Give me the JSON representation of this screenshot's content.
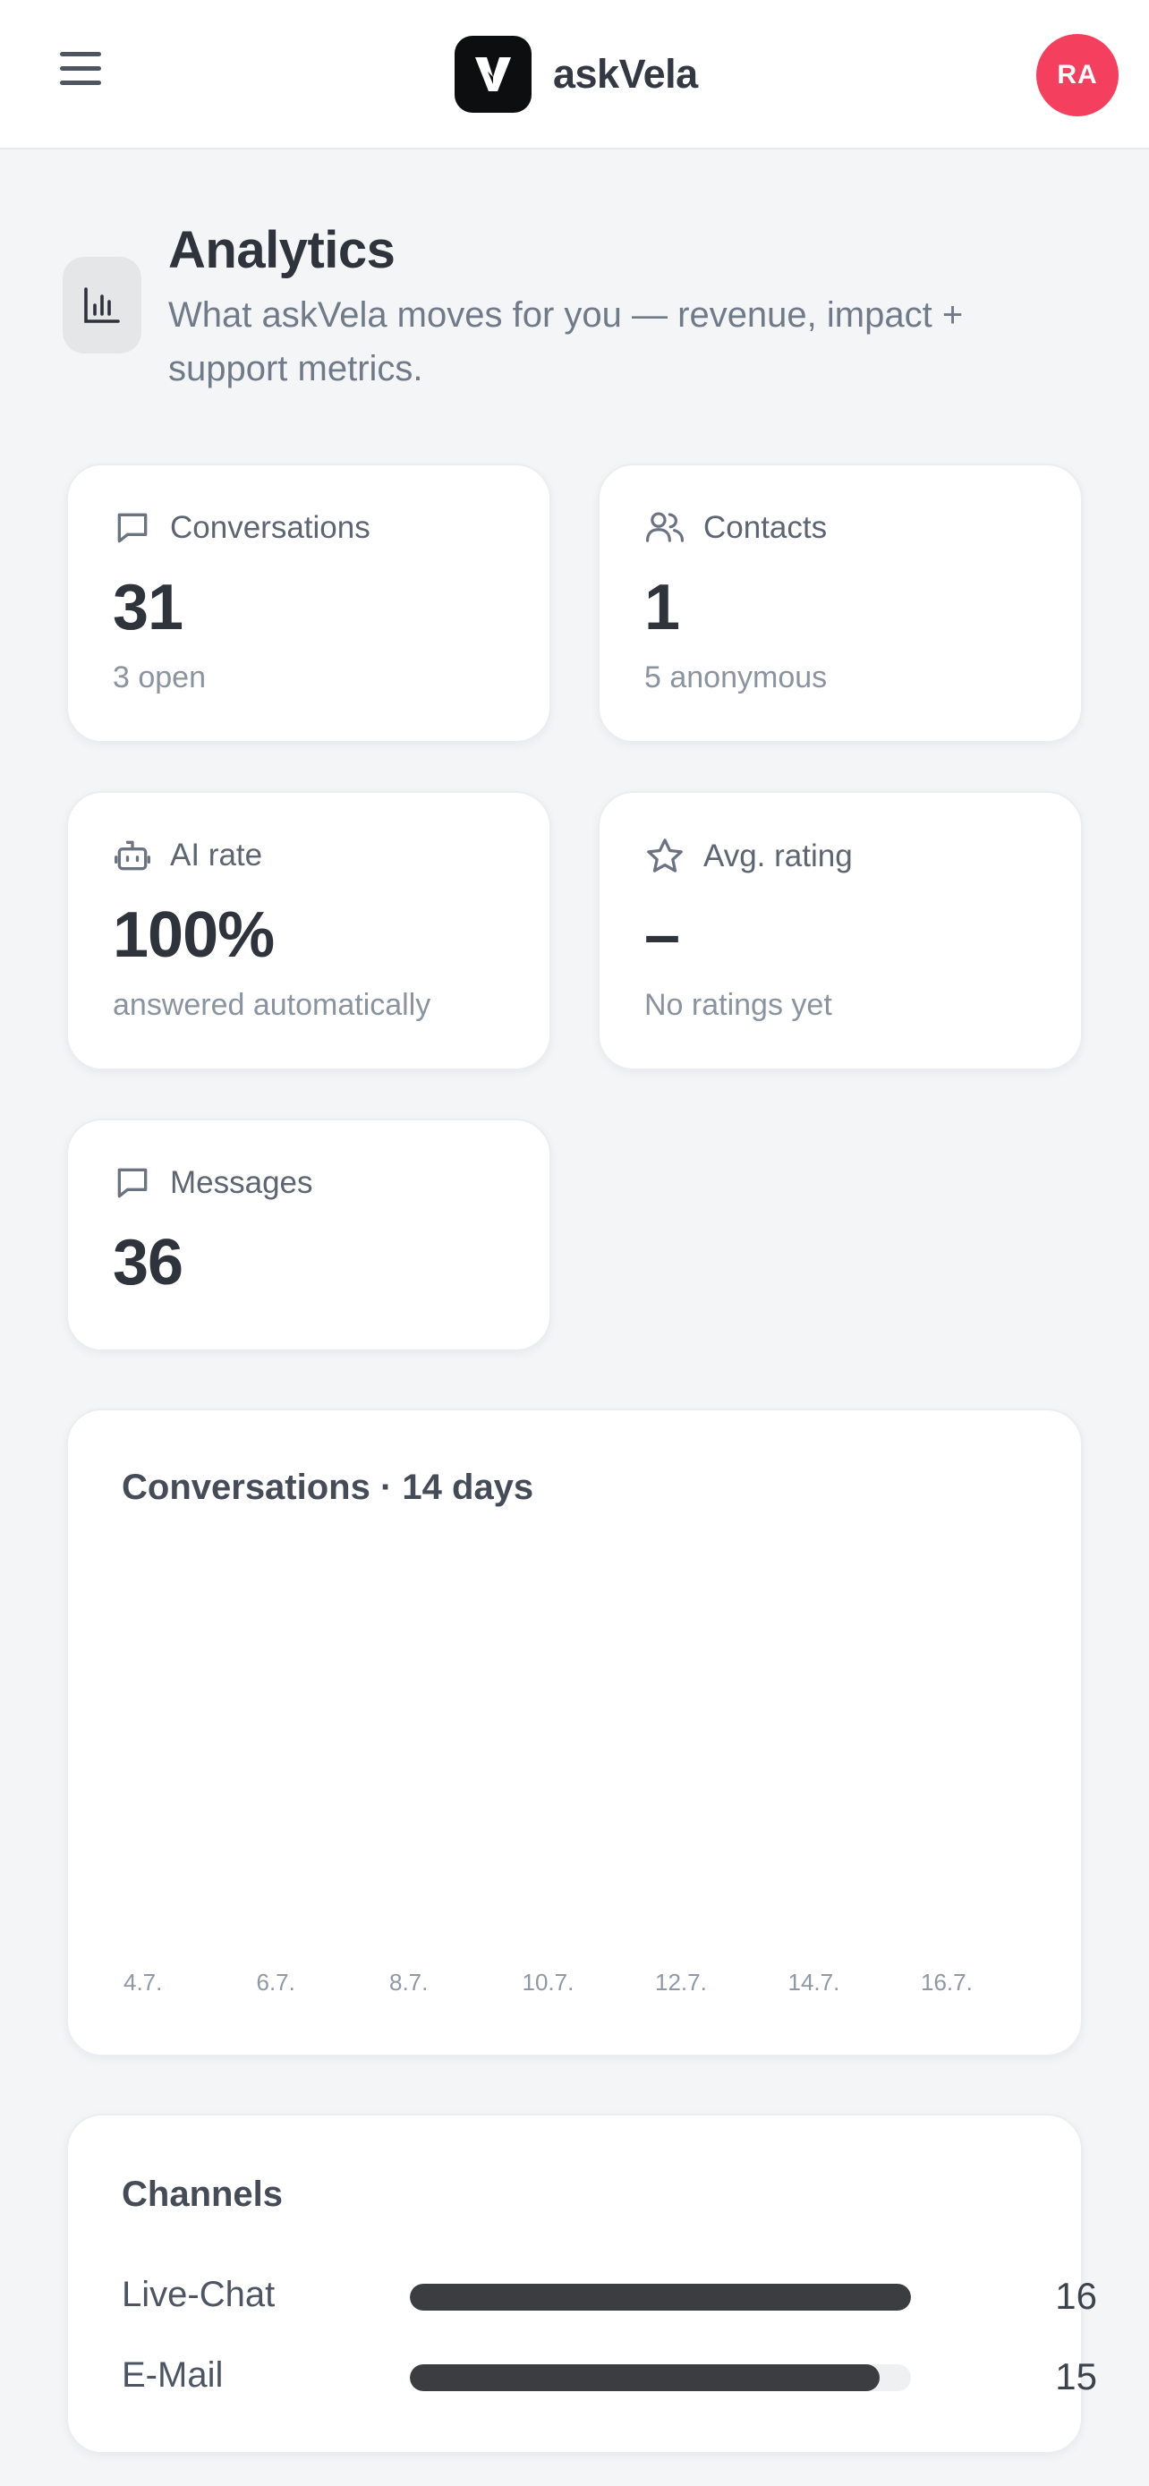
{
  "header": {
    "brand_name": "askVela",
    "avatar_initials": "RA",
    "menu_icon": "hamburger-menu-icon",
    "logo_icon": "askvela-logo-icon"
  },
  "page": {
    "title": "Analytics",
    "subtitle": "What askVela moves for you — revenue, impact + support metrics.",
    "icon": "bar-chart-icon"
  },
  "stats": {
    "conversations": {
      "label": "Conversations",
      "value": "31",
      "sub": "3 open",
      "icon": "chat-bubble-icon"
    },
    "contacts": {
      "label": "Contacts",
      "value": "1",
      "sub": "5 anonymous",
      "icon": "users-icon"
    },
    "ai_rate": {
      "label": "AI rate",
      "value": "100%",
      "sub": "answered automatically",
      "icon": "robot-icon"
    },
    "avg_rating": {
      "label": "Avg. rating",
      "value": "–",
      "sub": "No ratings yet",
      "icon": "star-icon"
    },
    "messages": {
      "label": "Messages",
      "value": "36",
      "icon": "chat-bubble-icon"
    }
  },
  "conversations_chart": {
    "title": "Conversations · 14 days",
    "ticks": [
      "4.7.",
      "6.7.",
      "8.7.",
      "10.7.",
      "12.7.",
      "14.7.",
      "16.7."
    ]
  },
  "channels": {
    "title": "Channels",
    "items": [
      {
        "name": "Live-Chat",
        "count": "16",
        "fraction": 1.0
      },
      {
        "name": "E-Mail",
        "count": "15",
        "fraction": 0.9375
      }
    ]
  },
  "colors": {
    "accent_avatar": "#f43f5e",
    "bar_fill": "#3b3d40",
    "background": "#f4f5f7"
  }
}
